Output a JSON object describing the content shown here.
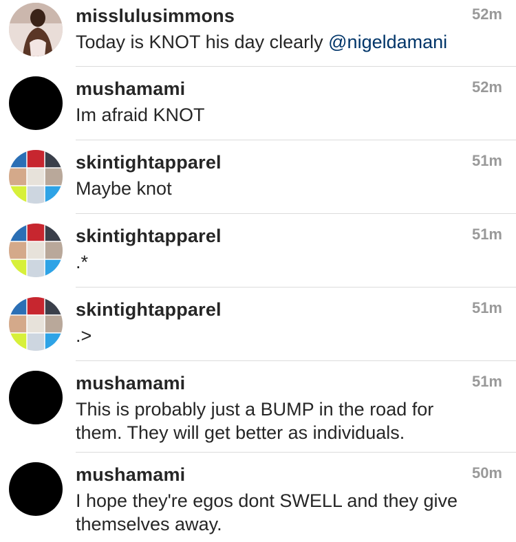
{
  "comments": [
    {
      "username": "misslulusimmons",
      "time": "52m",
      "text": "Today is KNOT his day clearly ",
      "mention": "@nigeldamani",
      "avatar": "photo"
    },
    {
      "username": "mushamami",
      "time": "52m",
      "text": "Im afraid KNOT",
      "avatar": "black"
    },
    {
      "username": "skintightapparel",
      "time": "51m",
      "text": "Maybe knot",
      "avatar": "grid"
    },
    {
      "username": "skintightapparel",
      "time": "51m",
      "text": ".*",
      "avatar": "grid"
    },
    {
      "username": "skintightapparel",
      "time": "51m",
      "text": ".>",
      "avatar": "grid"
    },
    {
      "username": "mushamami",
      "time": "51m",
      "text": "This is probably just a BUMP in the road for them. They will get better as individuals.",
      "avatar": "black"
    },
    {
      "username": "mushamami",
      "time": "50m",
      "text": "I hope they're egos dont SWELL and they give themselves away.",
      "avatar": "black"
    }
  ]
}
